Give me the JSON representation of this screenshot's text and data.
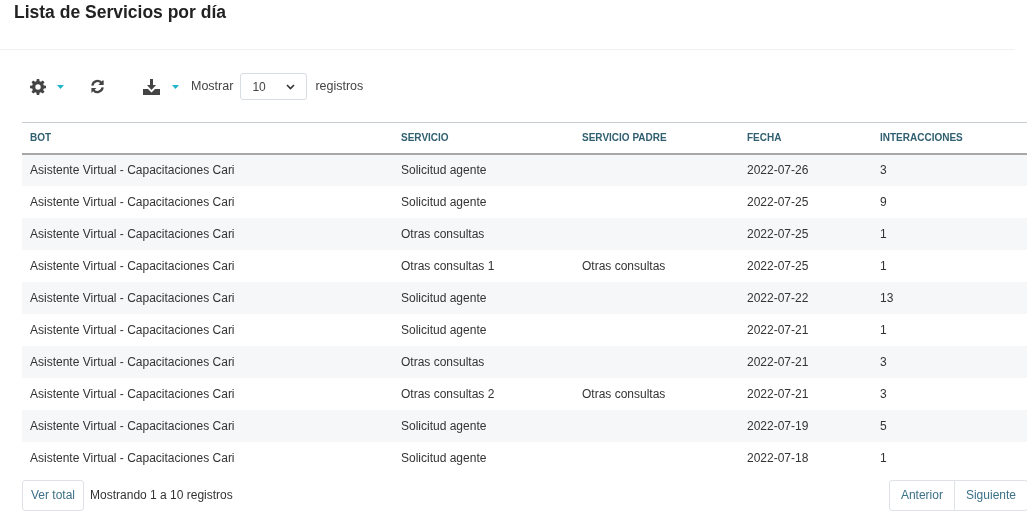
{
  "title": "Lista de Servicios por día",
  "toolbar": {
    "show_label": "Mostrar",
    "page_size": "10",
    "records_label": "registros"
  },
  "table": {
    "columns": [
      "BOT",
      "SERVICIO",
      "SERVICIO PADRE",
      "FECHA",
      "INTERACCIONES"
    ],
    "rows": [
      [
        "Asistente Virtual - Capacitaciones Cari",
        "Solicitud agente",
        "",
        "2022-07-26",
        "3"
      ],
      [
        "Asistente Virtual - Capacitaciones Cari",
        "Solicitud agente",
        "",
        "2022-07-25",
        "9"
      ],
      [
        "Asistente Virtual - Capacitaciones Cari",
        "Otras consultas",
        "",
        "2022-07-25",
        "1"
      ],
      [
        "Asistente Virtual - Capacitaciones Cari",
        "Otras consultas 1",
        "Otras consultas",
        "2022-07-25",
        "1"
      ],
      [
        "Asistente Virtual - Capacitaciones Cari",
        "Solicitud agente",
        "",
        "2022-07-22",
        "13"
      ],
      [
        "Asistente Virtual - Capacitaciones Cari",
        "Solicitud agente",
        "",
        "2022-07-21",
        "1"
      ],
      [
        "Asistente Virtual - Capacitaciones Cari",
        "Otras consultas",
        "",
        "2022-07-21",
        "3"
      ],
      [
        "Asistente Virtual - Capacitaciones Cari",
        "Otras consultas 2",
        "Otras consultas",
        "2022-07-21",
        "3"
      ],
      [
        "Asistente Virtual - Capacitaciones Cari",
        "Solicitud agente",
        "",
        "2022-07-19",
        "5"
      ],
      [
        "Asistente Virtual - Capacitaciones Cari",
        "Solicitud agente",
        "",
        "2022-07-18",
        "1"
      ]
    ]
  },
  "footer": {
    "total_button": "Ver total",
    "summary": "Mostrando 1 a 10 registros",
    "pagination": [
      "Anterior",
      "Siguiente"
    ]
  }
}
